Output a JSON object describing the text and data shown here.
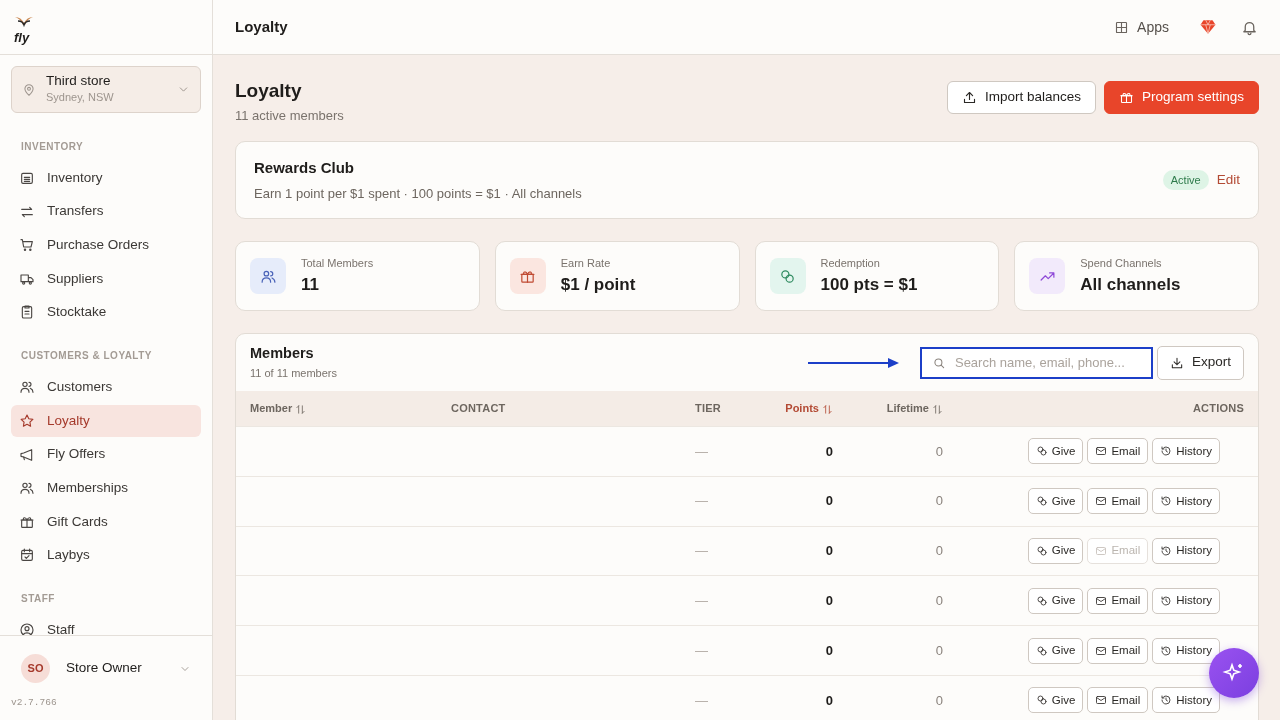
{
  "sidebar": {
    "logo_text": "fly",
    "store": {
      "name": "Third store",
      "location": "Sydney, NSW"
    },
    "sections": [
      {
        "title": "INVENTORY",
        "items": [
          {
            "label": "Inventory",
            "selected": false
          },
          {
            "label": "Transfers",
            "selected": false
          },
          {
            "label": "Purchase Orders",
            "selected": false
          },
          {
            "label": "Suppliers",
            "selected": false
          },
          {
            "label": "Stocktake",
            "selected": false
          }
        ]
      },
      {
        "title": "CUSTOMERS & LOYALTY",
        "items": [
          {
            "label": "Customers",
            "selected": false
          },
          {
            "label": "Loyalty",
            "selected": true
          },
          {
            "label": "Fly Offers",
            "selected": false
          },
          {
            "label": "Memberships",
            "selected": false
          },
          {
            "label": "Gift Cards",
            "selected": false
          },
          {
            "label": "Laybys",
            "selected": false
          }
        ]
      },
      {
        "title": "STAFF",
        "items": [
          {
            "label": "Staff",
            "selected": false
          }
        ]
      }
    ],
    "user": {
      "initials": "SO",
      "name": "Store Owner"
    },
    "version": "v2.7.766"
  },
  "topbar": {
    "title": "Loyalty",
    "apps_label": "Apps"
  },
  "header": {
    "title": "Loyalty",
    "subtitle": "11 active members",
    "buttons": [
      {
        "label": "Import balances",
        "kind": "secondary"
      },
      {
        "label": "Program settings",
        "kind": "primary"
      }
    ]
  },
  "program": {
    "name": "Rewards Club",
    "description": "Earn 1 point per $1 spent · 100 points = $1 · All channels",
    "status": "Active",
    "edit_label": "Edit"
  },
  "stats": [
    {
      "label": "Total Members",
      "value": "11",
      "color": "#e6ecfa"
    },
    {
      "label": "Earn Rate",
      "value": "$1 / point",
      "color": "#fbe6e0"
    },
    {
      "label": "Redemption",
      "value": "100 pts = $1",
      "color": "#e3f5ee"
    },
    {
      "label": "Spend Channels",
      "value": "All channels",
      "color": "#f2eafb"
    }
  ],
  "members": {
    "title": "Members",
    "count": "11 of 11 members",
    "search": {
      "placeholder": "Search name, email, phone..."
    },
    "export_label": "Export",
    "columns": [
      {
        "label": "Member",
        "sortable": true,
        "active": false
      },
      {
        "label": "CONTACT",
        "sortable": false,
        "active": false
      },
      {
        "label": "TIER",
        "sortable": false,
        "active": false
      },
      {
        "label": "Points",
        "sortable": true,
        "active": true
      },
      {
        "label": "Lifetime",
        "sortable": true,
        "active": false
      },
      {
        "label": "ACTIONS",
        "sortable": false,
        "active": false
      }
    ],
    "rows": [
      {
        "tier": "—",
        "points": "0",
        "lifetime": "0",
        "email_disabled": false,
        "actions": [
          "Give",
          "Email",
          "History"
        ]
      },
      {
        "tier": "—",
        "points": "0",
        "lifetime": "0",
        "email_disabled": false,
        "actions": [
          "Give",
          "Email",
          "History"
        ]
      },
      {
        "tier": "—",
        "points": "0",
        "lifetime": "0",
        "email_disabled": true,
        "actions": [
          "Give",
          "Email",
          "History"
        ]
      },
      {
        "tier": "—",
        "points": "0",
        "lifetime": "0",
        "email_disabled": false,
        "actions": [
          "Give",
          "Email",
          "History"
        ]
      },
      {
        "tier": "—",
        "points": "0",
        "lifetime": "0",
        "email_disabled": false,
        "actions": [
          "Give",
          "Email",
          "History"
        ]
      },
      {
        "tier": "—",
        "points": "0",
        "lifetime": "0",
        "email_disabled": false,
        "actions": [
          "Give",
          "Email",
          "History"
        ]
      }
    ]
  }
}
